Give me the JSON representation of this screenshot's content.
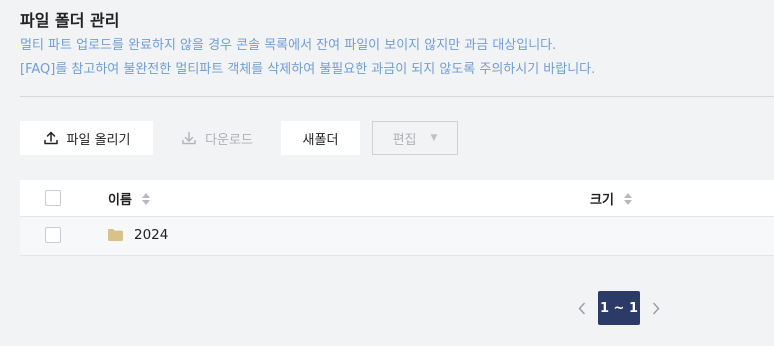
{
  "page": {
    "title": "파일 폴더 관리",
    "notice_line1": "멀티 파트 업로드를 완료하지 않을 경우 콘솔 목록에서 잔여 파일이 보이지 않지만 과금 대상입니다.",
    "notice_line2": "[FAQ]를 참고하여 불완전한 멀티파트 객체를 삭제하여 불필요한 과금이 되지 않도록 주의하시기 바랍니다."
  },
  "toolbar": {
    "upload_label": "파일 올리기",
    "download_label": "다운로드",
    "new_folder_label": "새폴더",
    "edit_label": "편집",
    "upload_icon": "upload-icon",
    "download_icon": "download-icon",
    "edit_icon": "caret-down-icon"
  },
  "table": {
    "columns": {
      "name": "이름",
      "size": "크기"
    },
    "rows": [
      {
        "name": "2024",
        "size": "",
        "icon": "folder-icon",
        "checked": false
      }
    ]
  },
  "pagination": {
    "current": "1 ~ 1",
    "prev_icon": "chevron-left-icon",
    "next_icon": "chevron-right-icon"
  },
  "colors": {
    "notice": "#6f9ed8",
    "pager_active": "#2b3a66",
    "folder": "#d9c28a"
  }
}
